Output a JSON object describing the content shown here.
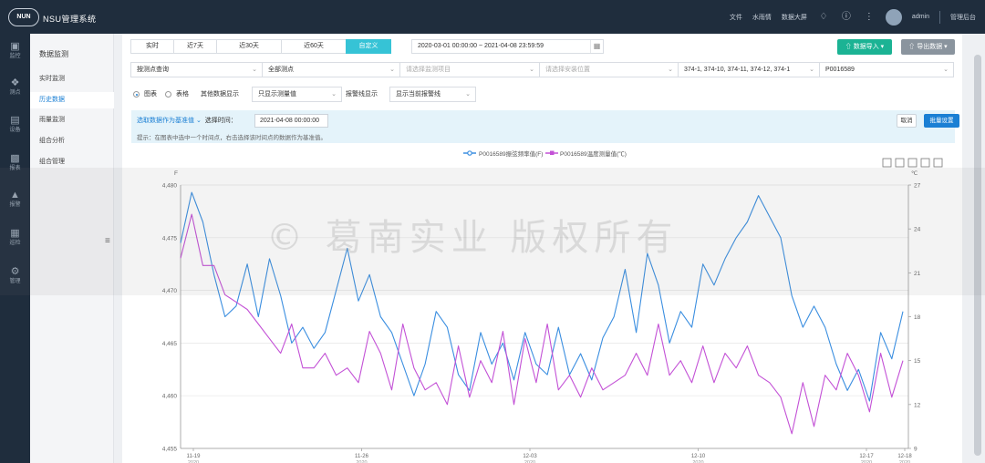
{
  "app": {
    "logo": "NUN",
    "title": "NSU管理系统"
  },
  "topbar": {
    "links": [
      "文件",
      "水雨情",
      "数据大屏"
    ],
    "user": "admin",
    "admin_link": "管理后台",
    "icons": [
      "bell-icon",
      "help-icon",
      "more-icon"
    ]
  },
  "iconnav": [
    {
      "label": "监控",
      "icon": "camera-icon"
    },
    {
      "label": "测点",
      "icon": "sensor-icon"
    },
    {
      "label": "设备",
      "icon": "device-icon"
    },
    {
      "label": "报表",
      "icon": "report-icon"
    },
    {
      "label": "报警",
      "icon": "alarm-icon"
    },
    {
      "label": "巡检",
      "icon": "calendar-icon"
    },
    {
      "label": "管理",
      "icon": "gear-icon"
    }
  ],
  "subnav": {
    "title": "数据监测",
    "items": [
      "实时监测",
      "历史数据",
      "雨量监测",
      "组合分析",
      "组合管理"
    ],
    "active": "历史数据"
  },
  "toolbar": {
    "tabs": [
      "实时",
      "近7天",
      "近30天",
      "近60天",
      "自定义"
    ],
    "active_tab": "自定义",
    "date_range": "2020-03-01 00:00:00 ~ 2021-04-08 23:59:59",
    "import_label": "数据导入",
    "export_label": "导出数据"
  },
  "filters": [
    {
      "value": "按测点查询",
      "placeholder": false
    },
    {
      "value": "全部测点",
      "placeholder": false
    },
    {
      "value": "请选择监测项目",
      "placeholder": true
    },
    {
      "value": "请选择安装位置",
      "placeholder": true
    },
    {
      "value": "374-1, 374-10, 374-11, 374-12, 374-1",
      "placeholder": false
    },
    {
      "value": "P0016589",
      "placeholder": false
    }
  ],
  "options": {
    "chart_label": "图表",
    "table_label": "表格",
    "other_data_label": "其他数据显示",
    "other_data_value": "只显示测量值",
    "alarm_label": "报警线显示",
    "alarm_value": "显示当前报警线"
  },
  "notice": {
    "select_label": "选取数据作为基准值",
    "time_label": "选择时间：",
    "time_value": "2021-04-08 00:00:00",
    "hint": "提示：在图表中选中一个时间点，右击选择该时间点的数据作为基准值。",
    "cancel_label": "取消",
    "confirm_label": "批量设置"
  },
  "watermark": "© 葛南实业 版权所有",
  "colors": {
    "series1": "#3a8ee0",
    "series2": "#c351d6",
    "accent": "#1a7fd4",
    "active_tab": "#36c3d6",
    "import_btn": "#1bb394"
  },
  "chart_data": {
    "type": "line",
    "legend": [
      "P0016589振弦频率值(F)",
      "P0016589温度测量值(℃)"
    ],
    "left_unit": "F",
    "right_unit": "℃",
    "y_left_ticks": [
      "4,480",
      "4,475",
      "4,470",
      "4,465",
      "4,460",
      "4,455"
    ],
    "y_right_ticks": [
      "27",
      "24",
      "21",
      "18",
      "15",
      "12",
      "9"
    ],
    "x_ticks": [
      {
        "date": "11-19",
        "year": "2020"
      },
      {
        "date": "11-26",
        "year": "2020"
      },
      {
        "date": "12-03",
        "year": "2020"
      },
      {
        "date": "12-10",
        "year": "2020"
      },
      {
        "date": "12-17",
        "year": "2020"
      },
      {
        "date": "12-18",
        "year": "2020"
      }
    ],
    "ylim_left": [
      4455,
      4480
    ],
    "ylim_right": [
      9,
      27
    ],
    "series": [
      {
        "name": "P0016589振弦频率值(F)",
        "axis": "left",
        "values": [
          4474.5,
          4479.3,
          4476.5,
          4471.5,
          4467.5,
          4468.5,
          4472.5,
          4467.5,
          4473.0,
          4469.5,
          4465.0,
          4466.5,
          4464.5,
          4466.0,
          4470.0,
          4474.0,
          4469.0,
          4471.5,
          4467.5,
          4466.0,
          4463.0,
          4460.0,
          4463.0,
          4468.0,
          4466.5,
          4462.0,
          4460.5,
          4466.0,
          4463.0,
          4465.0,
          4461.5,
          4466.0,
          4463.0,
          4462.0,
          4466.5,
          4462.0,
          4464.0,
          4461.5,
          4465.5,
          4467.5,
          4472.0,
          4466.0,
          4473.5,
          4470.5,
          4465.0,
          4468.0,
          4466.5,
          4472.5,
          4470.5,
          4473.0,
          4475.0,
          4476.5,
          4479.0,
          4477.0,
          4475.0,
          4469.5,
          4466.5,
          4468.5,
          4466.5,
          4463.0,
          4460.5,
          4462.5,
          4459.5,
          4466.0,
          4463.5,
          4468.0
        ]
      },
      {
        "name": "P0016589温度测量值(℃)",
        "axis": "right",
        "values": [
          22.0,
          25.0,
          21.5,
          21.5,
          19.5,
          19.0,
          18.5,
          17.5,
          16.5,
          15.5,
          17.5,
          14.5,
          14.5,
          15.5,
          14.0,
          14.5,
          13.5,
          17.0,
          15.5,
          13.0,
          17.5,
          14.5,
          13.0,
          13.5,
          12.0,
          16.0,
          12.5,
          15.0,
          13.5,
          17.0,
          12.0,
          16.5,
          13.5,
          17.5,
          13.0,
          14.0,
          12.5,
          14.5,
          13.0,
          13.5,
          14.0,
          15.5,
          14.0,
          17.5,
          14.0,
          15.0,
          13.5,
          16.0,
          13.5,
          15.5,
          14.5,
          16.0,
          14.0,
          13.5,
          12.5,
          10.0,
          13.5,
          10.5,
          14.0,
          13.0,
          15.5,
          14.0,
          11.5,
          15.5,
          12.5,
          15.0
        ]
      }
    ]
  }
}
